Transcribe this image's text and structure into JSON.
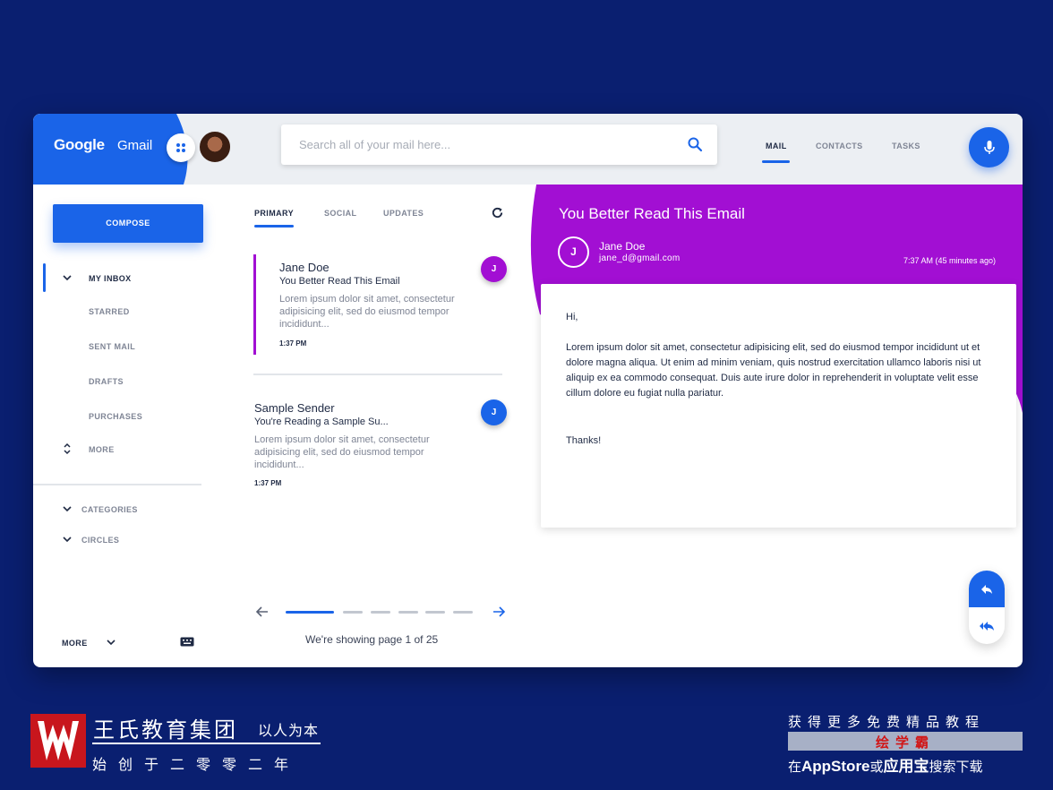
{
  "header": {
    "brand_google": "Google",
    "brand_gmail": "Gmail",
    "search_placeholder": "Search all of your mail here...",
    "nav": [
      "MAIL",
      "CONTACTS",
      "TASKS"
    ],
    "active_nav": "MAIL",
    "accent": "#1a64e8"
  },
  "sidebar": {
    "compose": "COMPOSE",
    "items": [
      "MY INBOX",
      "STARRED",
      "SENT MAIL",
      "DRAFTS",
      "PURCHASES",
      "MORE"
    ],
    "groups": [
      "CATEGORIES",
      "CIRCLES"
    ],
    "footer_more": "MORE"
  },
  "list": {
    "tabs": [
      "PRIMARY",
      "SOCIAL",
      "UPDATES"
    ],
    "emails": [
      {
        "from": "Jane Doe",
        "subject": "You Better Read This Email",
        "body": "Lorem ipsum dolor sit amet, consectetur adipisicing elit, sed do eiusmod tempor incididunt...",
        "time": "1:37 PM",
        "initial": "J",
        "color": "#a20fd3"
      },
      {
        "from": "Sample Sender",
        "subject": "You're Reading a Sample Su...",
        "body": "Lorem ipsum dolor sit amet, consectetur adipisicing elit, sed do eiusmod tempor incididunt...",
        "time": "1:37 PM",
        "initial": "J",
        "color": "#1a64e8"
      }
    ],
    "pager": "We're showing page 1 of 25"
  },
  "reader": {
    "title": "You Better Read This Email",
    "initial": "J",
    "sender_name": "Jane Doe",
    "sender_email": "jane_d@gmail.com",
    "time": "7:37 AM (45 minutes ago)",
    "greeting": "Hi,",
    "body": "Lorem ipsum dolor sit amet, consectetur adipisicing elit, sed do eiusmod tempor incididunt ut et dolore magna aliqua. Ut enim ad minim veniam, quis nostrud exercitation ullamco laboris nisi ut aliquip ex ea commodo consequat. Duis aute irure dolor in reprehenderit in voluptate velit esse cillum dolore eu fugiat nulla pariatur.",
    "signoff": "Thanks!",
    "accent": "#a20fd3"
  },
  "branding": {
    "name": "王氏教育集团",
    "tagline": "以人为本",
    "founded": "始创于二零零二年",
    "promo_line1": "获得更多免费精品教程",
    "promo_highlight": "绘学霸",
    "promo_line3_pre": "在",
    "promo_line3_app": "AppStore",
    "promo_line3_mid": "或",
    "promo_line3_store": "应用宝",
    "promo_line3_post": "搜索下载"
  }
}
